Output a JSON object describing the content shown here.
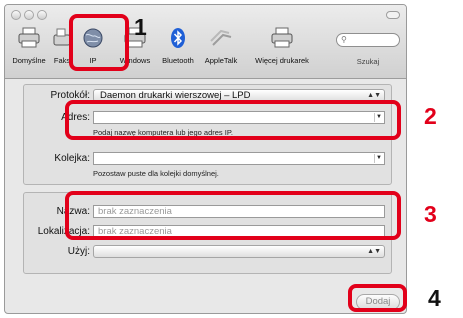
{
  "toolbar": {
    "items": [
      {
        "label": "Domyślne",
        "icon": "printer-default-icon"
      },
      {
        "label": "Faks",
        "icon": "fax-icon"
      },
      {
        "label": "IP",
        "icon": "ip-globe-icon"
      },
      {
        "label": "Windows",
        "icon": "windows-printer-icon"
      },
      {
        "label": "Bluetooth",
        "icon": "bluetooth-icon"
      },
      {
        "label": "AppleTalk",
        "icon": "appletalk-icon"
      },
      {
        "label": "Więcej drukarek",
        "icon": "more-printers-icon"
      }
    ],
    "search_label": "Szukaj"
  },
  "form": {
    "protocol_label": "Protokół:",
    "protocol_value": "Daemon drukarki wierszowej – LPD",
    "address_label": "Adres:",
    "address_value": "",
    "address_hint": "Podaj nazwę komputera lub jego adres IP.",
    "queue_label": "Kolejka:",
    "queue_value": "",
    "queue_hint": "Pozostaw puste dla kolejki domyślnej.",
    "name_label": "Nazwa:",
    "name_placeholder": "brak zaznaczenia",
    "location_label": "Lokalizacja:",
    "location_placeholder": "brak zaznaczenia",
    "use_label": "Użyj:",
    "use_value": ""
  },
  "add_button_label": "Dodaj",
  "callouts": [
    "1",
    "2",
    "3",
    "4"
  ],
  "colors": {
    "callout": "#e2001a",
    "bluetooth": "#1f5fd6"
  }
}
